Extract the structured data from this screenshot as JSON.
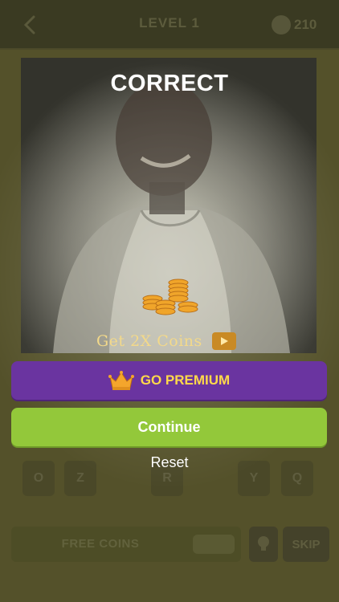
{
  "header": {
    "level_label": "LEVEL 1",
    "coin_count": "210",
    "back_icon": "chevron-left-icon",
    "coin_icon": "coin-icon"
  },
  "letters": [
    "O",
    "Z",
    "R",
    "Y",
    "Q"
  ],
  "bottom_bar": {
    "free_coins_label": "FREE COINS",
    "skip_label": "SKIP",
    "hint_icon": "bulb-icon",
    "video_icon": "video-play-icon"
  },
  "modal": {
    "title": "CORRECT",
    "double_coins_label": "Get 2X Coins",
    "premium_label": "GO PREMIUM",
    "continue_label": "Continue",
    "reset_label": "Reset"
  },
  "colors": {
    "premium_bg": "#6a34a0",
    "premium_text": "#ffd94a",
    "continue_bg": "#93c83a",
    "gold": "#f3d98a"
  }
}
